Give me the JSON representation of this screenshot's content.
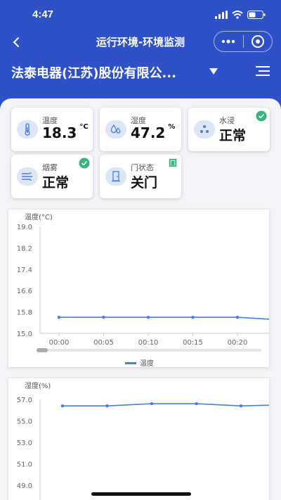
{
  "status": {
    "time": "4:47"
  },
  "nav": {
    "title": "运行环境-环境监测"
  },
  "company": {
    "name": "法泰电器(江苏)股份有限公..."
  },
  "cards": [
    {
      "label": "温度",
      "value": "18.3",
      "unit": "°C",
      "icon": "thermometer-icon"
    },
    {
      "label": "湿度",
      "value": "47.2",
      "unit": "%",
      "icon": "humidity-drops-icon"
    },
    {
      "label": "水浸",
      "value": "正常",
      "icon": "water-drops-icon",
      "badge": "check"
    },
    {
      "label": "烟雾",
      "value": "正常",
      "icon": "smoke-icon",
      "badge": "check"
    },
    {
      "label": "门状态",
      "value": "关门",
      "icon": "door-icon",
      "badge": "door-status"
    }
  ],
  "colors": {
    "primary": "#2f51c8",
    "line": "#4a7fd6",
    "ok": "#36b37e"
  },
  "chart_data": [
    {
      "type": "line",
      "ylabel": "温度(°C)",
      "ylim": [
        15.0,
        19.0
      ],
      "y_ticks": [
        "19.0",
        "18.2",
        "17.4",
        "16.6",
        "15.8",
        "15.0"
      ],
      "x_ticks": [
        "00:00",
        "00:05",
        "00:10",
        "00:15",
        "00:20"
      ],
      "legend": "温度",
      "series": [
        {
          "name": "温度",
          "x": [
            "00:00",
            "00:05",
            "00:10",
            "00:15",
            "00:20",
            "00:25"
          ],
          "values": [
            15.6,
            15.6,
            15.6,
            15.6,
            15.6,
            15.5
          ]
        }
      ]
    },
    {
      "type": "line",
      "ylabel": "湿度(%)",
      "y_ticks": [
        "57.0",
        "55.0",
        "53.0",
        "51.0",
        "49.0"
      ],
      "series": [
        {
          "values": [
            56.4,
            56.4,
            56.6,
            56.6,
            56.4,
            56.5
          ]
        }
      ]
    }
  ]
}
